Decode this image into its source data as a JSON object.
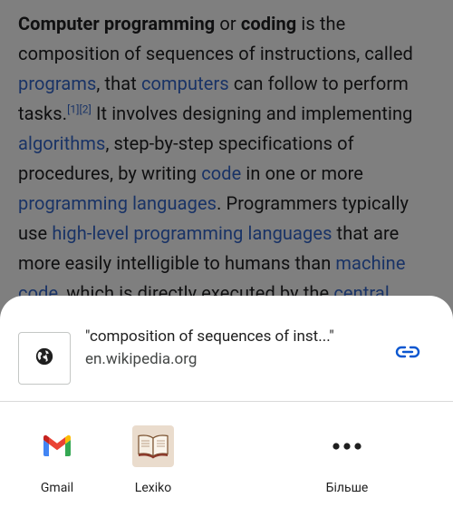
{
  "article": {
    "segments": [
      {
        "t": "Computer programming",
        "style": "bold"
      },
      {
        "t": " or ",
        "style": "text"
      },
      {
        "t": "coding",
        "style": "bold"
      },
      {
        "t": " is the composition of sequences of instructions, called ",
        "style": "text"
      },
      {
        "t": "programs",
        "style": "link"
      },
      {
        "t": ", that ",
        "style": "text"
      },
      {
        "t": "computers",
        "style": "link"
      },
      {
        "t": " can follow to perform tasks.",
        "style": "text"
      },
      {
        "t": "[1][2]",
        "style": "sup"
      },
      {
        "t": " It involves designing and implementing ",
        "style": "text"
      },
      {
        "t": "algorithms",
        "style": "link"
      },
      {
        "t": ", step-by-step specifications of procedures, by writing ",
        "style": "text"
      },
      {
        "t": "code",
        "style": "link"
      },
      {
        "t": " in one or more ",
        "style": "text"
      },
      {
        "t": "programming languages",
        "style": "link"
      },
      {
        "t": ". Programmers typically use ",
        "style": "text"
      },
      {
        "t": "high-level programming languages",
        "style": "link"
      },
      {
        "t": " that are more easily intelligible to humans than ",
        "style": "text"
      },
      {
        "t": "machine code",
        "style": "link"
      },
      {
        "t": ", which is directly executed by the ",
        "style": "text"
      },
      {
        "t": "central",
        "style": "link"
      }
    ]
  },
  "share_sheet": {
    "preview_title": "\"composition of sequences of inst...\"",
    "preview_url": "en.wikipedia.org",
    "thumb_icon": "globe-icon",
    "copy_icon": "link-icon",
    "targets": [
      {
        "label": "Gmail",
        "icon": "gmail-icon"
      },
      {
        "label": "Lexiko",
        "icon": "lexiko-book-icon"
      },
      {
        "label": "Більше",
        "icon": "more-horizontal-icon"
      }
    ]
  },
  "colors": {
    "link": "#3366cc",
    "accent": "#0b57d0",
    "scrim": "rgba(0,0,0,0.5)"
  }
}
